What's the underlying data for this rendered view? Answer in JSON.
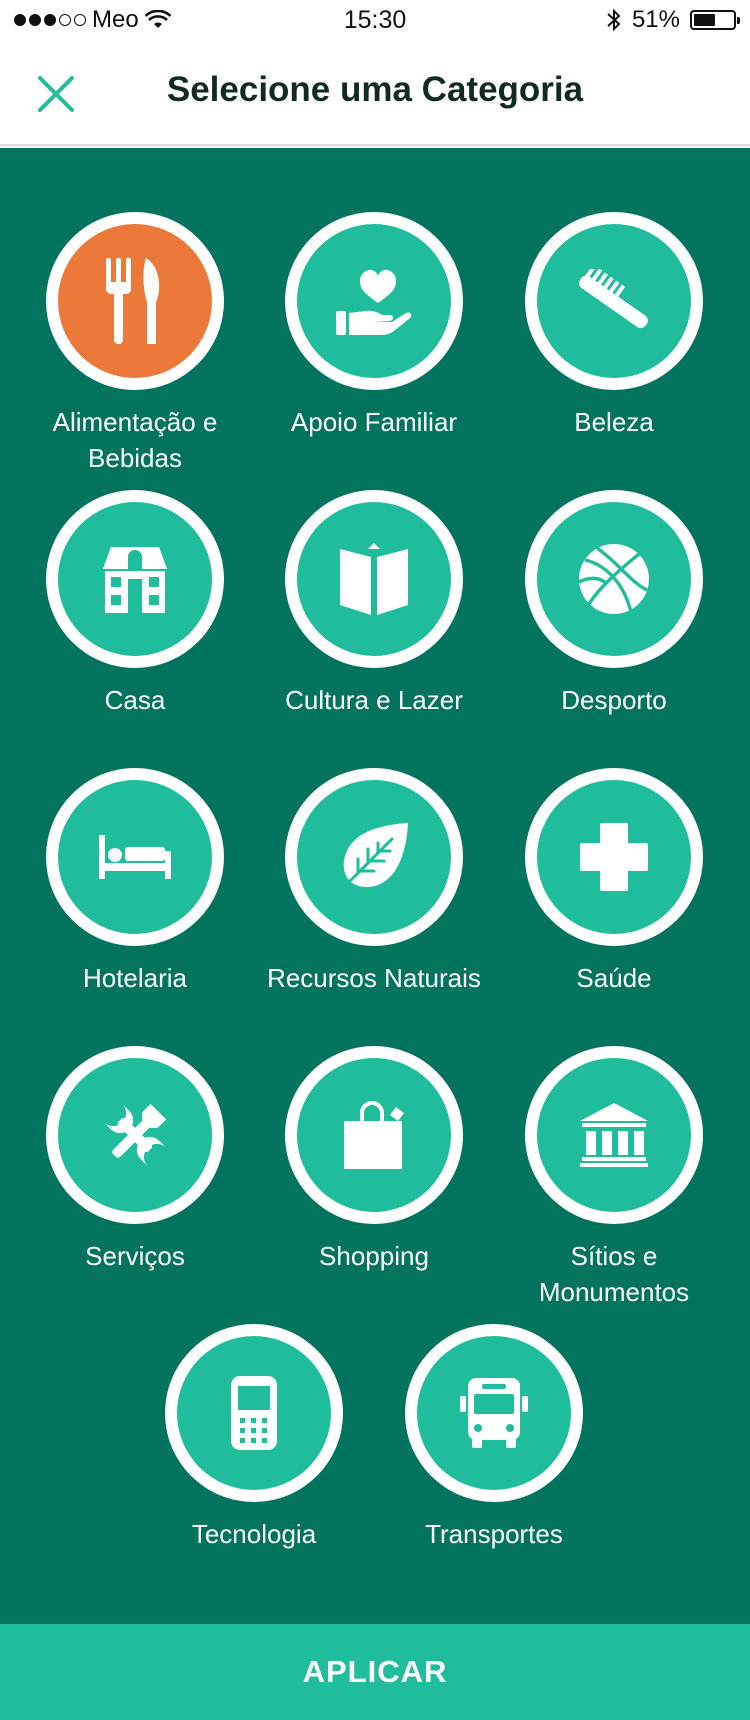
{
  "status_bar": {
    "carrier": "Meo",
    "time": "15:30",
    "battery": "51%",
    "battery_level": 0.51
  },
  "header": {
    "title": "Selecione uma Categoria",
    "close_icon": "close-icon"
  },
  "colors": {
    "header_accent": "#1fbd9b",
    "background": "#02735c",
    "circle": "#1fbd9b",
    "selected": "#ec793a",
    "ring": "#ffffff"
  },
  "categories": [
    {
      "label": "Alimentação e Bebidas",
      "icon": "cutlery-icon",
      "selected": true
    },
    {
      "label": "Apoio Familiar",
      "icon": "heart-hand-icon",
      "selected": false
    },
    {
      "label": "Beleza",
      "icon": "comb-icon",
      "selected": false
    },
    {
      "label": "Casa",
      "icon": "house-icon",
      "selected": false
    },
    {
      "label": "Cultura e Lazer",
      "icon": "book-icon",
      "selected": false
    },
    {
      "label": "Desporto",
      "icon": "basketball-icon",
      "selected": false
    },
    {
      "label": "Hotelaria",
      "icon": "bed-icon",
      "selected": false
    },
    {
      "label": "Recursos Naturais",
      "icon": "leaf-icon",
      "selected": false
    },
    {
      "label": "Saúde",
      "icon": "health-cross-icon",
      "selected": false
    },
    {
      "label": "Serviços",
      "icon": "tools-icon",
      "selected": false
    },
    {
      "label": "Shopping",
      "icon": "shopping-bag-icon",
      "selected": false
    },
    {
      "label": "Sítios e Monumentos",
      "icon": "monument-icon",
      "selected": false
    },
    {
      "label": "Tecnologia",
      "icon": "mobile-phone-icon",
      "selected": false
    },
    {
      "label": "Transportes",
      "icon": "bus-icon",
      "selected": false
    }
  ],
  "apply_button": {
    "label": "APLICAR"
  }
}
